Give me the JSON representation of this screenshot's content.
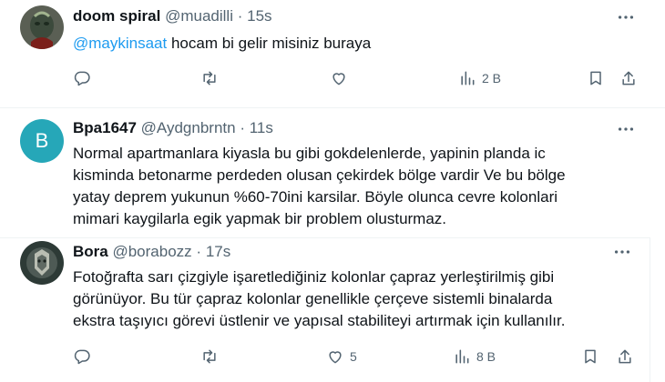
{
  "tweet1": {
    "name": "doom spiral",
    "handle": "@muadilli",
    "dot": "·",
    "time": "15s",
    "mention": "@maykinsaat",
    "text": " hocam bi gelir misiniz buraya",
    "views": "2 B"
  },
  "tweet2": {
    "avatar_letter": "B",
    "avatar_color": "#26a7b8",
    "name": "Bpa1647",
    "handle": "@Aydgnbrntn",
    "dot": "·",
    "time": "11s",
    "lines": [
      "Normal apartmanlara kiyasla bu gibi gokdelenlerde, yapinin planda ic",
      "kisminda betonarme perdeden olusan çekirdek bölge vardir Ve bu bölge",
      "yatay deprem yukunun %60-70ini karsilar. Böyle olunca cevre kolonlari",
      "mimari kaygilarla egik yapmak bir problem olusturmaz."
    ]
  },
  "tweet3": {
    "name": "Bora",
    "handle": "@borabozz",
    "dot": "·",
    "time": "17s",
    "lines": [
      "Fotoğrafta sarı çizgiyle işaretlediğiniz kolonlar çapraz yerleştirilmiş gibi",
      "görünüyor. Bu tür çapraz kolonlar genellikle çerçeve sistemli binalarda",
      "ekstra taşıyıcı görevi üstlenir ve yapısal stabiliteyi artırmak için kullanılır."
    ],
    "likes": "5",
    "views": "8 B"
  },
  "colors": {
    "mention": "#1d9bf0",
    "secondary": "#536471",
    "text": "#0f1419"
  },
  "icons": [
    "reply-icon",
    "retweet-icon",
    "like-icon",
    "views-icon",
    "bookmark-icon",
    "share-icon",
    "more-icon"
  ]
}
